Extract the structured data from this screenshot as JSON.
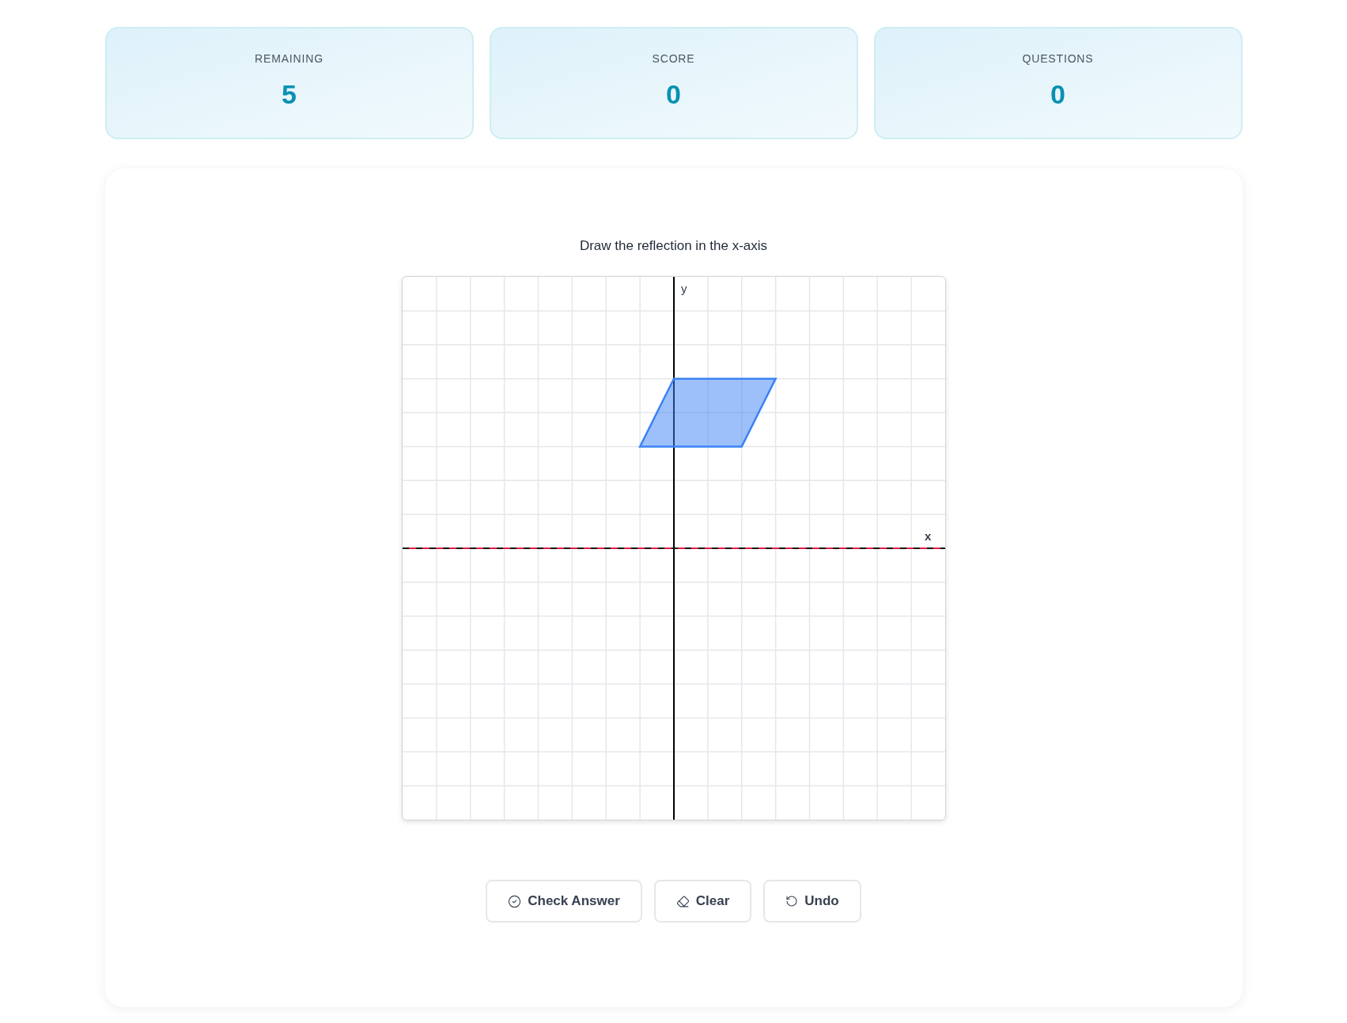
{
  "stats": [
    {
      "label": "REMAINING",
      "value": "5"
    },
    {
      "label": "SCORE",
      "value": "0"
    },
    {
      "label": "QUESTIONS",
      "value": "0"
    }
  ],
  "question": {
    "prompt": "Draw the reflection in the x-axis",
    "grid": {
      "x_label": "x",
      "y_label": "y"
    }
  },
  "buttons": [
    {
      "label": "Check Answer",
      "kind": "check"
    },
    {
      "label": "Clear",
      "kind": "clear"
    },
    {
      "label": "Undo",
      "kind": "undo"
    }
  ]
}
